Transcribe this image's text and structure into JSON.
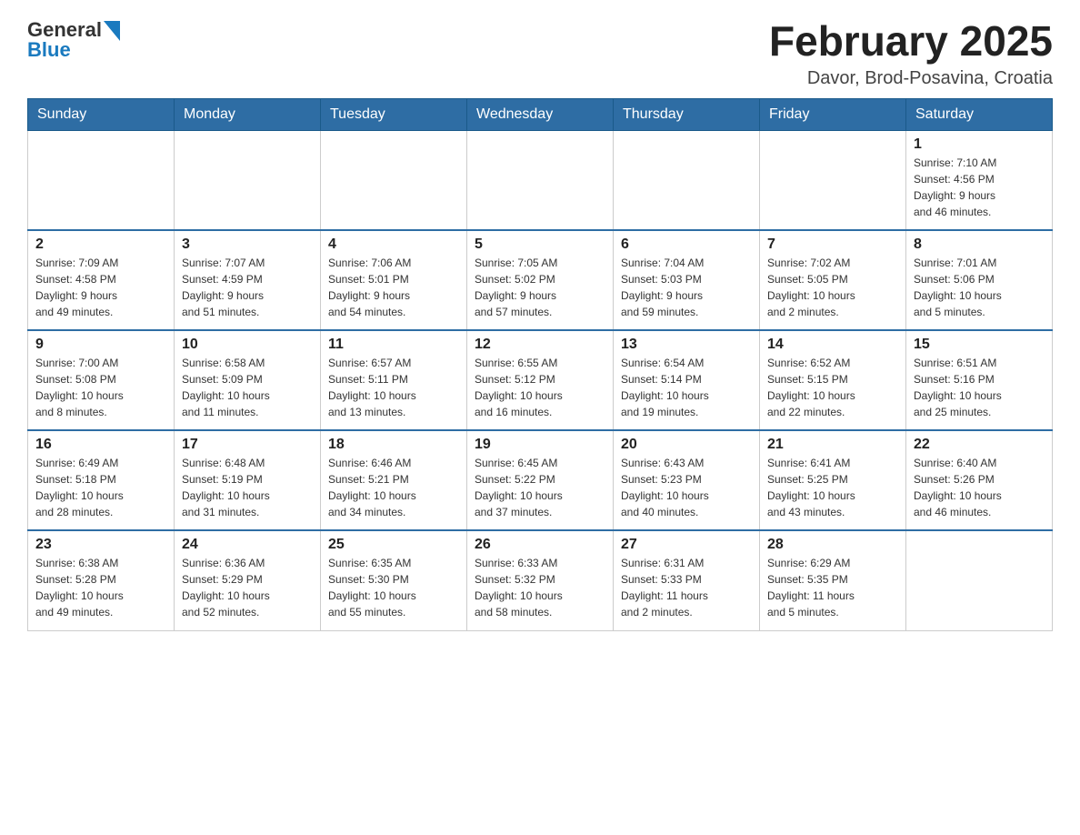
{
  "header": {
    "logo": {
      "general": "General",
      "blue": "Blue"
    },
    "title": "February 2025",
    "location": "Davor, Brod-Posavina, Croatia"
  },
  "days_of_week": [
    "Sunday",
    "Monday",
    "Tuesday",
    "Wednesday",
    "Thursday",
    "Friday",
    "Saturday"
  ],
  "weeks": [
    [
      {
        "day": "",
        "info": ""
      },
      {
        "day": "",
        "info": ""
      },
      {
        "day": "",
        "info": ""
      },
      {
        "day": "",
        "info": ""
      },
      {
        "day": "",
        "info": ""
      },
      {
        "day": "",
        "info": ""
      },
      {
        "day": "1",
        "info": "Sunrise: 7:10 AM\nSunset: 4:56 PM\nDaylight: 9 hours\nand 46 minutes."
      }
    ],
    [
      {
        "day": "2",
        "info": "Sunrise: 7:09 AM\nSunset: 4:58 PM\nDaylight: 9 hours\nand 49 minutes."
      },
      {
        "day": "3",
        "info": "Sunrise: 7:07 AM\nSunset: 4:59 PM\nDaylight: 9 hours\nand 51 minutes."
      },
      {
        "day": "4",
        "info": "Sunrise: 7:06 AM\nSunset: 5:01 PM\nDaylight: 9 hours\nand 54 minutes."
      },
      {
        "day": "5",
        "info": "Sunrise: 7:05 AM\nSunset: 5:02 PM\nDaylight: 9 hours\nand 57 minutes."
      },
      {
        "day": "6",
        "info": "Sunrise: 7:04 AM\nSunset: 5:03 PM\nDaylight: 9 hours\nand 59 minutes."
      },
      {
        "day": "7",
        "info": "Sunrise: 7:02 AM\nSunset: 5:05 PM\nDaylight: 10 hours\nand 2 minutes."
      },
      {
        "day": "8",
        "info": "Sunrise: 7:01 AM\nSunset: 5:06 PM\nDaylight: 10 hours\nand 5 minutes."
      }
    ],
    [
      {
        "day": "9",
        "info": "Sunrise: 7:00 AM\nSunset: 5:08 PM\nDaylight: 10 hours\nand 8 minutes."
      },
      {
        "day": "10",
        "info": "Sunrise: 6:58 AM\nSunset: 5:09 PM\nDaylight: 10 hours\nand 11 minutes."
      },
      {
        "day": "11",
        "info": "Sunrise: 6:57 AM\nSunset: 5:11 PM\nDaylight: 10 hours\nand 13 minutes."
      },
      {
        "day": "12",
        "info": "Sunrise: 6:55 AM\nSunset: 5:12 PM\nDaylight: 10 hours\nand 16 minutes."
      },
      {
        "day": "13",
        "info": "Sunrise: 6:54 AM\nSunset: 5:14 PM\nDaylight: 10 hours\nand 19 minutes."
      },
      {
        "day": "14",
        "info": "Sunrise: 6:52 AM\nSunset: 5:15 PM\nDaylight: 10 hours\nand 22 minutes."
      },
      {
        "day": "15",
        "info": "Sunrise: 6:51 AM\nSunset: 5:16 PM\nDaylight: 10 hours\nand 25 minutes."
      }
    ],
    [
      {
        "day": "16",
        "info": "Sunrise: 6:49 AM\nSunset: 5:18 PM\nDaylight: 10 hours\nand 28 minutes."
      },
      {
        "day": "17",
        "info": "Sunrise: 6:48 AM\nSunset: 5:19 PM\nDaylight: 10 hours\nand 31 minutes."
      },
      {
        "day": "18",
        "info": "Sunrise: 6:46 AM\nSunset: 5:21 PM\nDaylight: 10 hours\nand 34 minutes."
      },
      {
        "day": "19",
        "info": "Sunrise: 6:45 AM\nSunset: 5:22 PM\nDaylight: 10 hours\nand 37 minutes."
      },
      {
        "day": "20",
        "info": "Sunrise: 6:43 AM\nSunset: 5:23 PM\nDaylight: 10 hours\nand 40 minutes."
      },
      {
        "day": "21",
        "info": "Sunrise: 6:41 AM\nSunset: 5:25 PM\nDaylight: 10 hours\nand 43 minutes."
      },
      {
        "day": "22",
        "info": "Sunrise: 6:40 AM\nSunset: 5:26 PM\nDaylight: 10 hours\nand 46 minutes."
      }
    ],
    [
      {
        "day": "23",
        "info": "Sunrise: 6:38 AM\nSunset: 5:28 PM\nDaylight: 10 hours\nand 49 minutes."
      },
      {
        "day": "24",
        "info": "Sunrise: 6:36 AM\nSunset: 5:29 PM\nDaylight: 10 hours\nand 52 minutes."
      },
      {
        "day": "25",
        "info": "Sunrise: 6:35 AM\nSunset: 5:30 PM\nDaylight: 10 hours\nand 55 minutes."
      },
      {
        "day": "26",
        "info": "Sunrise: 6:33 AM\nSunset: 5:32 PM\nDaylight: 10 hours\nand 58 minutes."
      },
      {
        "day": "27",
        "info": "Sunrise: 6:31 AM\nSunset: 5:33 PM\nDaylight: 11 hours\nand 2 minutes."
      },
      {
        "day": "28",
        "info": "Sunrise: 6:29 AM\nSunset: 5:35 PM\nDaylight: 11 hours\nand 5 minutes."
      },
      {
        "day": "",
        "info": ""
      }
    ]
  ]
}
